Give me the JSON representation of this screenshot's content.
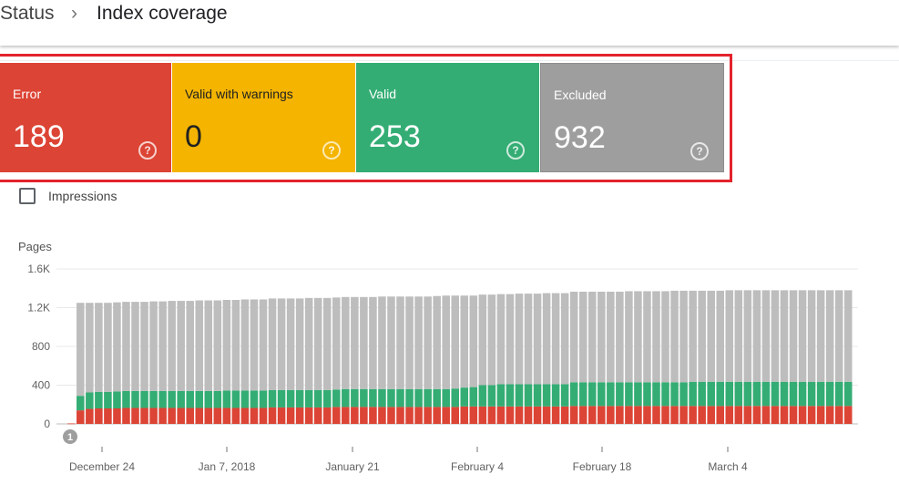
{
  "header": {
    "breadcrumb": "Status",
    "separator": "›",
    "title": "Index coverage"
  },
  "cards": [
    {
      "label": "Error",
      "value": "189",
      "color": "#dc4435"
    },
    {
      "label": "Valid with warnings",
      "value": "0",
      "color": "#f4b400"
    },
    {
      "label": "Valid",
      "value": "253",
      "color": "#34ad74"
    },
    {
      "label": "Excluded",
      "value": "932",
      "color": "#9e9e9e"
    }
  ],
  "help_icon": "?",
  "impressions_checkbox": {
    "label": "Impressions",
    "checked": false
  },
  "annotation_marker": "1",
  "chart_data": {
    "type": "bar",
    "stacked": true,
    "ylabel": "Pages",
    "yticks": [
      "0",
      "400",
      "800",
      "1.2K",
      "1.6K"
    ],
    "ylim": [
      0,
      1600
    ],
    "xtick_labels": [
      "December 24",
      "Jan 7, 2018",
      "January 21",
      "February 4",
      "February 18",
      "March 4"
    ],
    "series": [
      {
        "name": "Error",
        "color": "#dc4435",
        "values": [
          5,
          140,
          155,
          160,
          160,
          160,
          165,
          165,
          165,
          165,
          165,
          165,
          165,
          165,
          165,
          165,
          165,
          165,
          165,
          165,
          165,
          165,
          170,
          170,
          170,
          170,
          170,
          170,
          170,
          175,
          175,
          175,
          175,
          175,
          175,
          175,
          175,
          175,
          175,
          175,
          175,
          175,
          175,
          180,
          180,
          180,
          180,
          180,
          180,
          180,
          180,
          180,
          180,
          180,
          180,
          185,
          185,
          185,
          185,
          185,
          185,
          185,
          185,
          185,
          185,
          185,
          185,
          185,
          185,
          185,
          185,
          185,
          185,
          185,
          185,
          185,
          185,
          185,
          185,
          185,
          185,
          185,
          185,
          185,
          185,
          185
        ]
      },
      {
        "name": "Valid with warnings",
        "color": "#f4b400",
        "values": [
          0,
          0,
          0,
          0,
          0,
          0,
          0,
          0,
          0,
          0,
          0,
          0,
          0,
          0,
          0,
          0,
          0,
          0,
          0,
          0,
          0,
          0,
          0,
          0,
          0,
          0,
          0,
          0,
          0,
          0,
          0,
          0,
          0,
          0,
          0,
          0,
          0,
          0,
          0,
          0,
          0,
          0,
          0,
          0,
          0,
          0,
          0,
          0,
          0,
          0,
          0,
          0,
          0,
          0,
          0,
          0,
          0,
          0,
          0,
          0,
          0,
          0,
          0,
          0,
          0,
          0,
          0,
          0,
          0,
          0,
          0,
          0,
          0,
          0,
          0,
          0,
          0,
          0,
          0,
          0,
          0,
          0,
          0,
          0,
          0,
          0
        ]
      },
      {
        "name": "Valid",
        "color": "#34ad74",
        "values": [
          0,
          150,
          170,
          170,
          170,
          175,
          175,
          175,
          175,
          175,
          175,
          175,
          175,
          175,
          175,
          175,
          175,
          180,
          180,
          180,
          180,
          180,
          180,
          180,
          180,
          180,
          180,
          180,
          180,
          180,
          185,
          185,
          185,
          185,
          185,
          185,
          185,
          185,
          185,
          185,
          185,
          185,
          190,
          195,
          200,
          220,
          220,
          230,
          230,
          230,
          230,
          230,
          230,
          230,
          230,
          245,
          245,
          245,
          245,
          245,
          245,
          245,
          245,
          245,
          245,
          245,
          245,
          245,
          250,
          250,
          250,
          250,
          250,
          250,
          250,
          250,
          250,
          250,
          250,
          250,
          250,
          250,
          250,
          250,
          250,
          250
        ]
      },
      {
        "name": "Excluded",
        "color": "#bdbdbd",
        "values": [
          0,
          960,
          925,
          920,
          920,
          920,
          920,
          920,
          920,
          925,
          925,
          930,
          930,
          930,
          935,
          935,
          935,
          935,
          935,
          940,
          940,
          940,
          945,
          945,
          945,
          945,
          950,
          950,
          950,
          950,
          950,
          950,
          950,
          950,
          955,
          955,
          955,
          955,
          955,
          955,
          960,
          965,
          960,
          950,
          945,
          935,
          935,
          930,
          930,
          935,
          935,
          935,
          940,
          940,
          940,
          935,
          935,
          935,
          935,
          935,
          935,
          940,
          940,
          940,
          940,
          940,
          945,
          945,
          940,
          940,
          940,
          940,
          945,
          945,
          945,
          945,
          945,
          945,
          945,
          945,
          945,
          945,
          945,
          945,
          945,
          945
        ]
      }
    ]
  }
}
